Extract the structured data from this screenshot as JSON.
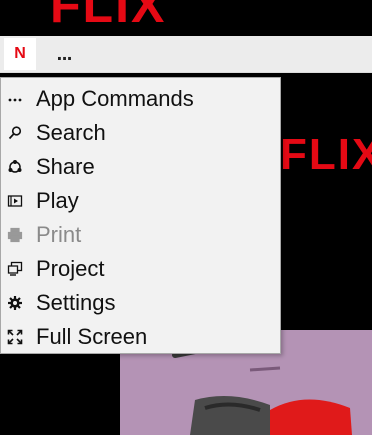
{
  "background": {
    "brand_text": "FLIX"
  },
  "titlebar": {
    "app_letter": "N",
    "more_label": "..."
  },
  "menu": {
    "items": [
      {
        "label": "App Commands",
        "icon": "more-dots-icon",
        "enabled": true
      },
      {
        "label": "Search",
        "icon": "search-icon",
        "enabled": true
      },
      {
        "label": "Share",
        "icon": "share-icon",
        "enabled": true
      },
      {
        "label": "Play",
        "icon": "play-icon",
        "enabled": true
      },
      {
        "label": "Print",
        "icon": "print-icon",
        "enabled": false
      },
      {
        "label": "Project",
        "icon": "project-icon",
        "enabled": true
      },
      {
        "label": "Settings",
        "icon": "gear-icon",
        "enabled": true
      },
      {
        "label": "Full Screen",
        "icon": "fullscreen-icon",
        "enabled": true
      }
    ]
  },
  "colors": {
    "brand_red": "#e50914",
    "menu_bg": "#f2f2f2",
    "titlebar_bg": "#ececec",
    "disabled_text": "#8a8a8a"
  }
}
